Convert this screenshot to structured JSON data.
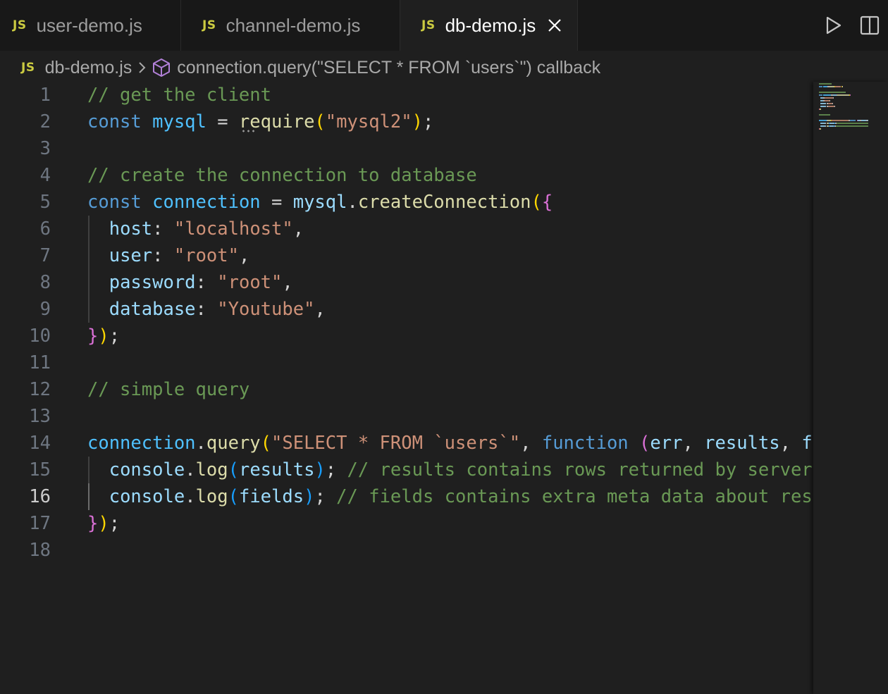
{
  "tabs": [
    {
      "badge": "JS",
      "label": "user-demo.js",
      "active": false
    },
    {
      "badge": "JS",
      "label": "channel-demo.js",
      "active": false
    },
    {
      "badge": "JS",
      "label": "db-demo.js",
      "active": true,
      "close_icon": "close-icon"
    }
  ],
  "toolbar": {
    "run_icon": "play-icon",
    "split_icon": "split-editor-icon"
  },
  "breadcrumb": {
    "badge": "JS",
    "file": "db-demo.js",
    "separator_icon": "chevron-right-icon",
    "symbol_icon": "symbol-cube-icon",
    "symbol": "connection.query(\"SELECT * FROM `users`\") callback"
  },
  "editor": {
    "current_line": 16,
    "line_numbers": [
      "1",
      "2",
      "3",
      "4",
      "5",
      "6",
      "7",
      "8",
      "9",
      "10",
      "11",
      "12",
      "13",
      "14",
      "15",
      "16",
      "17",
      "18"
    ],
    "lines": [
      {
        "tokens": [
          {
            "t": "// get the client",
            "c": "com"
          }
        ]
      },
      {
        "tokens": [
          {
            "t": "const",
            "c": "kw"
          },
          {
            "t": " ",
            "c": "op"
          },
          {
            "t": "mysql",
            "c": "const"
          },
          {
            "t": " = ",
            "c": "op"
          },
          {
            "t": "require",
            "c": "fn"
          },
          {
            "t": "(",
            "c": "br1"
          },
          {
            "t": "\"mysql2\"",
            "c": "str"
          },
          {
            "t": ")",
            "c": "br1"
          },
          {
            "t": ";",
            "c": "op"
          }
        ]
      },
      {
        "tokens": []
      },
      {
        "tokens": [
          {
            "t": "// create the connection to database",
            "c": "com"
          }
        ]
      },
      {
        "tokens": [
          {
            "t": "const",
            "c": "kw"
          },
          {
            "t": " ",
            "c": "op"
          },
          {
            "t": "connection",
            "c": "const"
          },
          {
            "t": " = ",
            "c": "op"
          },
          {
            "t": "mysql",
            "c": "var"
          },
          {
            "t": ".",
            "c": "op"
          },
          {
            "t": "createConnection",
            "c": "fn"
          },
          {
            "t": "(",
            "c": "br1"
          },
          {
            "t": "{",
            "c": "br2"
          }
        ]
      },
      {
        "tokens": [
          {
            "t": "  ",
            "c": "op"
          },
          {
            "t": "host",
            "c": "var"
          },
          {
            "t": ": ",
            "c": "op"
          },
          {
            "t": "\"localhost\"",
            "c": "str"
          },
          {
            "t": ",",
            "c": "op"
          }
        ]
      },
      {
        "tokens": [
          {
            "t": "  ",
            "c": "op"
          },
          {
            "t": "user",
            "c": "var"
          },
          {
            "t": ": ",
            "c": "op"
          },
          {
            "t": "\"root\"",
            "c": "str"
          },
          {
            "t": ",",
            "c": "op"
          }
        ]
      },
      {
        "tokens": [
          {
            "t": "  ",
            "c": "op"
          },
          {
            "t": "password",
            "c": "var"
          },
          {
            "t": ": ",
            "c": "op"
          },
          {
            "t": "\"root\"",
            "c": "str"
          },
          {
            "t": ",",
            "c": "op"
          }
        ]
      },
      {
        "tokens": [
          {
            "t": "  ",
            "c": "op"
          },
          {
            "t": "database",
            "c": "var"
          },
          {
            "t": ": ",
            "c": "op"
          },
          {
            "t": "\"Youtube\"",
            "c": "str"
          },
          {
            "t": ",",
            "c": "op"
          }
        ]
      },
      {
        "tokens": [
          {
            "t": "}",
            "c": "br2"
          },
          {
            "t": ")",
            "c": "br1"
          },
          {
            "t": ";",
            "c": "op"
          }
        ]
      },
      {
        "tokens": []
      },
      {
        "tokens": [
          {
            "t": "// simple query",
            "c": "com"
          }
        ]
      },
      {
        "tokens": []
      },
      {
        "tokens": [
          {
            "t": "connection",
            "c": "const"
          },
          {
            "t": ".",
            "c": "op"
          },
          {
            "t": "query",
            "c": "fn"
          },
          {
            "t": "(",
            "c": "br1"
          },
          {
            "t": "\"SELECT * FROM `users`\"",
            "c": "str"
          },
          {
            "t": ", ",
            "c": "op"
          },
          {
            "t": "function",
            "c": "kw"
          },
          {
            "t": " ",
            "c": "op"
          },
          {
            "t": "(",
            "c": "br2"
          },
          {
            "t": "err",
            "c": "var"
          },
          {
            "t": ", ",
            "c": "op"
          },
          {
            "t": "results",
            "c": "var"
          },
          {
            "t": ", ",
            "c": "op"
          },
          {
            "t": "f",
            "c": "var"
          }
        ]
      },
      {
        "tokens": [
          {
            "t": "  ",
            "c": "op"
          },
          {
            "t": "console",
            "c": "var"
          },
          {
            "t": ".",
            "c": "op"
          },
          {
            "t": "log",
            "c": "fn"
          },
          {
            "t": "(",
            "c": "br3"
          },
          {
            "t": "results",
            "c": "var"
          },
          {
            "t": ")",
            "c": "br3"
          },
          {
            "t": "; ",
            "c": "op"
          },
          {
            "t": "// results contains rows returned by server",
            "c": "com"
          }
        ]
      },
      {
        "tokens": [
          {
            "t": "  ",
            "c": "op"
          },
          {
            "t": "console",
            "c": "var"
          },
          {
            "t": ".",
            "c": "op"
          },
          {
            "t": "log",
            "c": "fn"
          },
          {
            "t": "(",
            "c": "br3"
          },
          {
            "t": "fields",
            "c": "var"
          },
          {
            "t": ")",
            "c": "br3"
          },
          {
            "t": "; ",
            "c": "op"
          },
          {
            "t": "// fields contains extra meta data about res",
            "c": "com"
          }
        ]
      },
      {
        "tokens": [
          {
            "t": "}",
            "c": "br2"
          },
          {
            "t": ")",
            "c": "br1"
          },
          {
            "t": ";",
            "c": "op"
          }
        ]
      },
      {
        "tokens": []
      }
    ]
  },
  "colors": {
    "background": "#1f1f1f",
    "tab_inactive": "#181818",
    "js_badge": "#cbcb41",
    "comment": "#6a9955",
    "keyword": "#569cd6",
    "string": "#ce9178",
    "function": "#dcdcaa"
  }
}
